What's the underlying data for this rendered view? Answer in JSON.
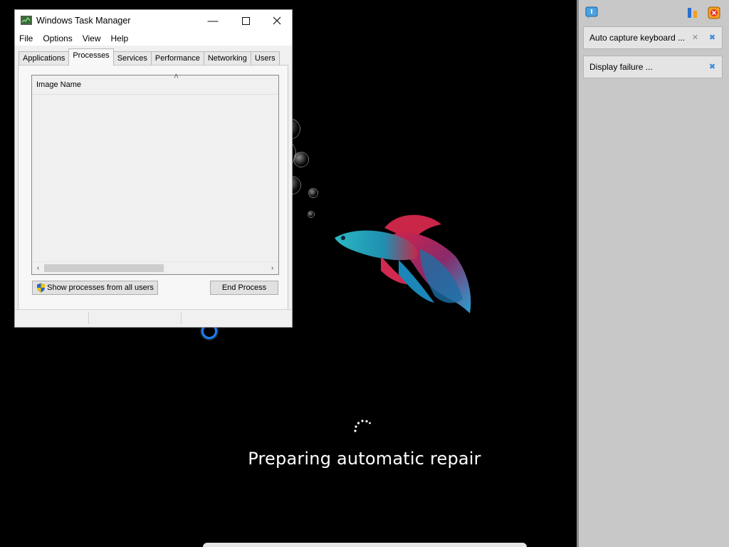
{
  "task_manager": {
    "title": "Windows Task Manager",
    "menu": [
      "File",
      "Options",
      "View",
      "Help"
    ],
    "tabs": [
      "Applications",
      "Processes",
      "Services",
      "Performance",
      "Networking",
      "Users"
    ],
    "active_tab": "Processes",
    "column_header": "Image Name",
    "show_all_button": "Show processes from all users",
    "end_process_button": "End Process"
  },
  "desktop": {
    "status_text": "Preparing automatic repair"
  },
  "side_panel": {
    "items": [
      {
        "label": "Auto capture keyboard ..."
      },
      {
        "label": "Display failure ..."
      }
    ]
  },
  "colors": {
    "accent": "#1e7ef0",
    "side_panel_bg": "#c8c8c8",
    "window_bg": "#f0f0f0"
  }
}
